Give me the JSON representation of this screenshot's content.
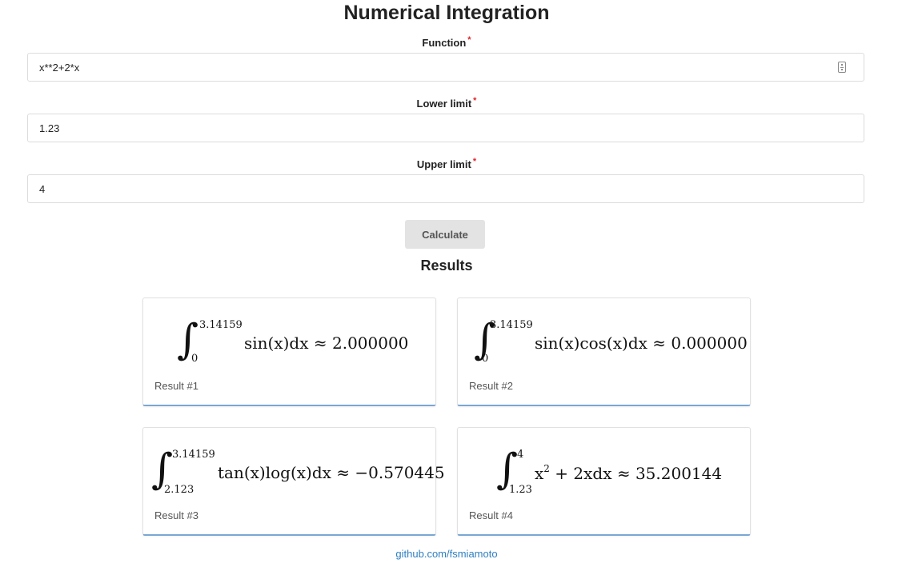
{
  "page": {
    "title": "Numerical Integration",
    "footer_link": "github.com/fsmiamoto"
  },
  "form": {
    "function_label": "Function",
    "function_value": "x**2+2*x",
    "lower_label": "Lower limit",
    "lower_value": "1.23",
    "upper_label": "Upper limit",
    "upper_value": "4",
    "required_mark": "*",
    "calculate_label": "Calculate"
  },
  "results": {
    "title": "Results",
    "items": [
      {
        "label": "Result #1",
        "upper": "3.14159",
        "lower": "0",
        "expr": "sin(x)dx ≈ 2.000000"
      },
      {
        "label": "Result #2",
        "upper": "3.14159",
        "lower": "0",
        "expr": "sin(x)cos(x)dx ≈ 0.000000"
      },
      {
        "label": "Result #3",
        "upper": "3.14159",
        "lower": "2.123",
        "expr": "tan(x)log(x)dx ≈ −0.570445"
      },
      {
        "label": "Result #4",
        "upper": "4",
        "lower": "1.23",
        "expr_base": "x",
        "expr_exp": "2",
        "expr_rest": " + 2xdx ≈ 35.200144"
      }
    ]
  },
  "icons": {
    "field_icon": "form-fill-icon"
  }
}
